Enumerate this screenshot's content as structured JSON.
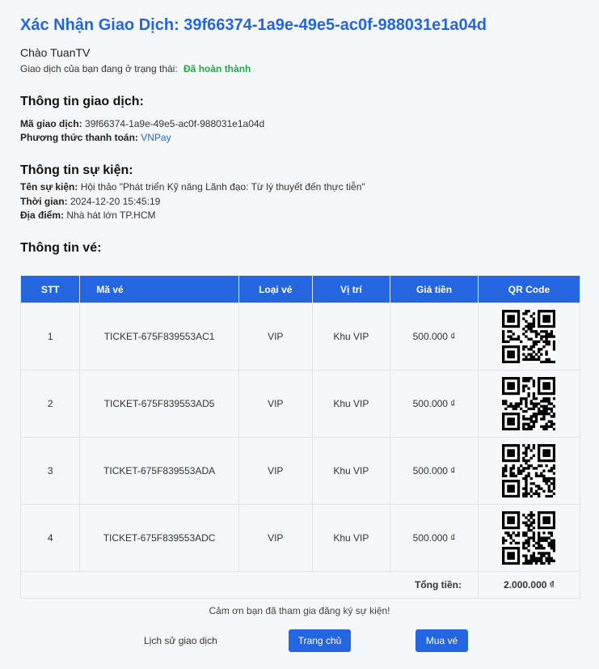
{
  "header": {
    "title": "Xác Nhận Giao Dịch: 39f66374-1a9e-49e5-ac0f-988031e1a04d",
    "greeting": "Chào TuanTV",
    "status_prefix": "Giao dịch của bạn đang ở trạng thái:",
    "status_value": "Đã hoàn thành",
    "status_color": "#22a84a"
  },
  "transaction": {
    "heading": "Thông tin giao dịch:",
    "id_label": "Mã giao dịch:",
    "id_value": "39f66374-1a9e-49e5-ac0f-988031e1a04d",
    "method_label": "Phương thức thanh toán:",
    "method_value": "VNPay"
  },
  "event": {
    "heading": "Thông tin sự kiện:",
    "name_label": "Tên sự kiện:",
    "name_value": "Hội thảo \"Phát triển Kỹ năng Lãnh đạo: Từ lý thuyết đến thực tiễn\"",
    "time_label": "Thời gian:",
    "time_value": "2024-12-20 15:45:19",
    "place_label": "Địa điểm:",
    "place_value": "Nhà hát lớn TP.HCM"
  },
  "tickets": {
    "heading": "Thông tin vé:",
    "columns": [
      "STT",
      "Mã vé",
      "Loại vé",
      "Vị trí",
      "Giá tiền",
      "QR Code"
    ],
    "rows": [
      {
        "stt": "1",
        "code": "TICKET-675F839553AC1",
        "type": "VIP",
        "location": "Khu VIP",
        "price": "500.000 ₫",
        "qr_icon": "qr-code-icon"
      },
      {
        "stt": "2",
        "code": "TICKET-675F839553AD5",
        "type": "VIP",
        "location": "Khu VIP",
        "price": "500.000 ₫",
        "qr_icon": "qr-code-icon"
      },
      {
        "stt": "3",
        "code": "TICKET-675F839553ADA",
        "type": "VIP",
        "location": "Khu VIP",
        "price": "500.000 ₫",
        "qr_icon": "qr-code-icon"
      },
      {
        "stt": "4",
        "code": "TICKET-675F839553ADC",
        "type": "VIP",
        "location": "Khu VIP",
        "price": "500.000 ₫",
        "qr_icon": "qr-code-icon"
      }
    ],
    "total_label": "Tổng tiền:",
    "total_value": "2.000.000 ₫"
  },
  "footer": {
    "thanks": "Cảm ơn bạn đã tham gia đăng ký sự kiện!",
    "history_link": "Lịch sử giao dịch",
    "home_button": "Trang chủ",
    "buy_button": "Mua vé"
  },
  "colors": {
    "accent": "#2466e0",
    "success": "#22a84a"
  }
}
